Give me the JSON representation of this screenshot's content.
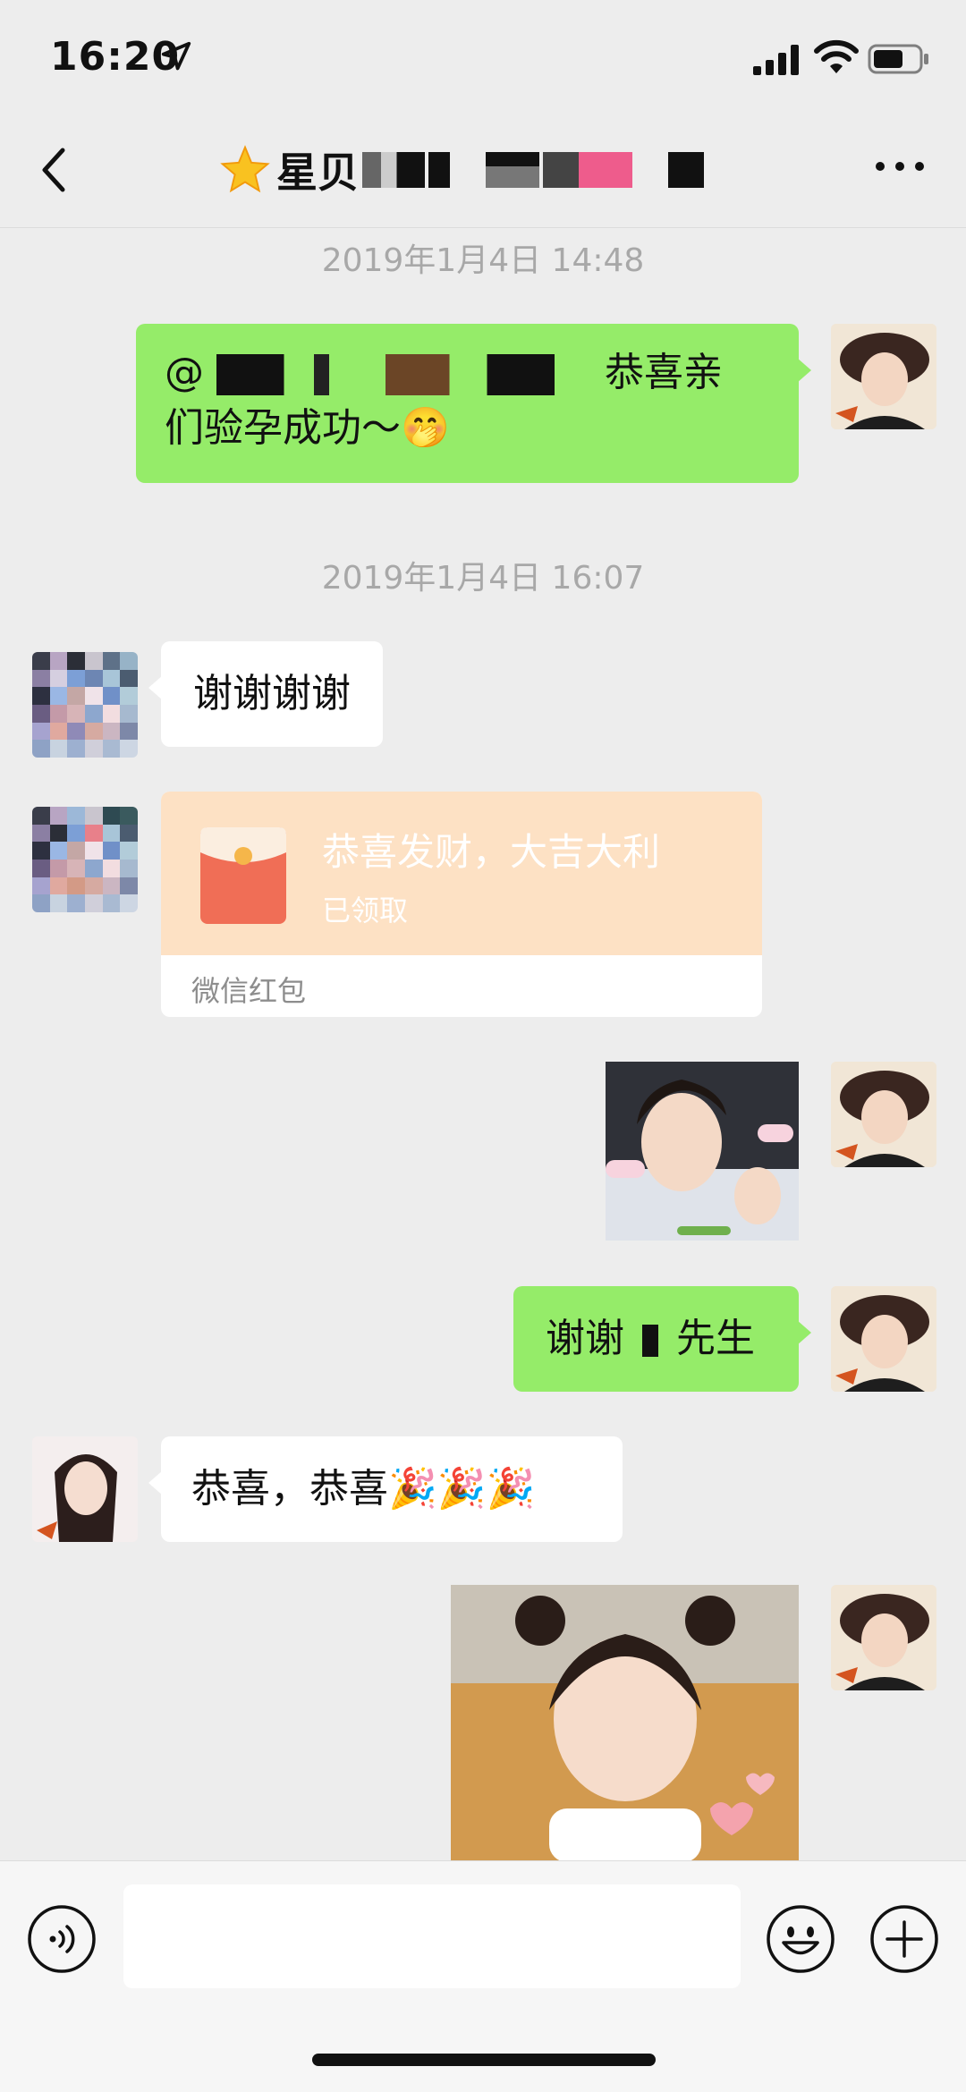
{
  "status_bar": {
    "time": "16:20",
    "icons": [
      "location-arrow-icon",
      "cellular-signal-icon",
      "wifi-icon",
      "battery-icon"
    ]
  },
  "nav": {
    "back_icon": "chevron-left-icon",
    "title_emoji": "star-icon",
    "title": "星贝",
    "more_icon": "more-dots-icon"
  },
  "messages": {
    "ts1": "2019年1月4日 14:48",
    "m1_prefix": "@",
    "m1_text": "恭喜亲",
    "m1_text2": "们验孕成功～",
    "m1_emoji": "🤭",
    "ts2": "2019年1月4日 16:07",
    "m2_text": "谢谢谢谢",
    "red_packet": {
      "greeting": "恭喜发财，大吉大利",
      "status": "已领取",
      "footer": "微信红包"
    },
    "m4_text_a": "谢谢",
    "m4_text_b": "先生",
    "m5_text": "恭喜，恭喜",
    "m5_emoji": "🎉🎉🎉"
  },
  "input_bar": {
    "voice_icon": "voice-icon",
    "emoji_icon": "emoji-smile-icon",
    "plus_icon": "plus-circle-icon",
    "placeholder": ""
  },
  "colors": {
    "background": "#ededed",
    "bubble_green": "#95ec69",
    "bubble_white": "#ffffff",
    "red_packet": "#fde1c4",
    "timestamp": "#a8a8a8"
  }
}
